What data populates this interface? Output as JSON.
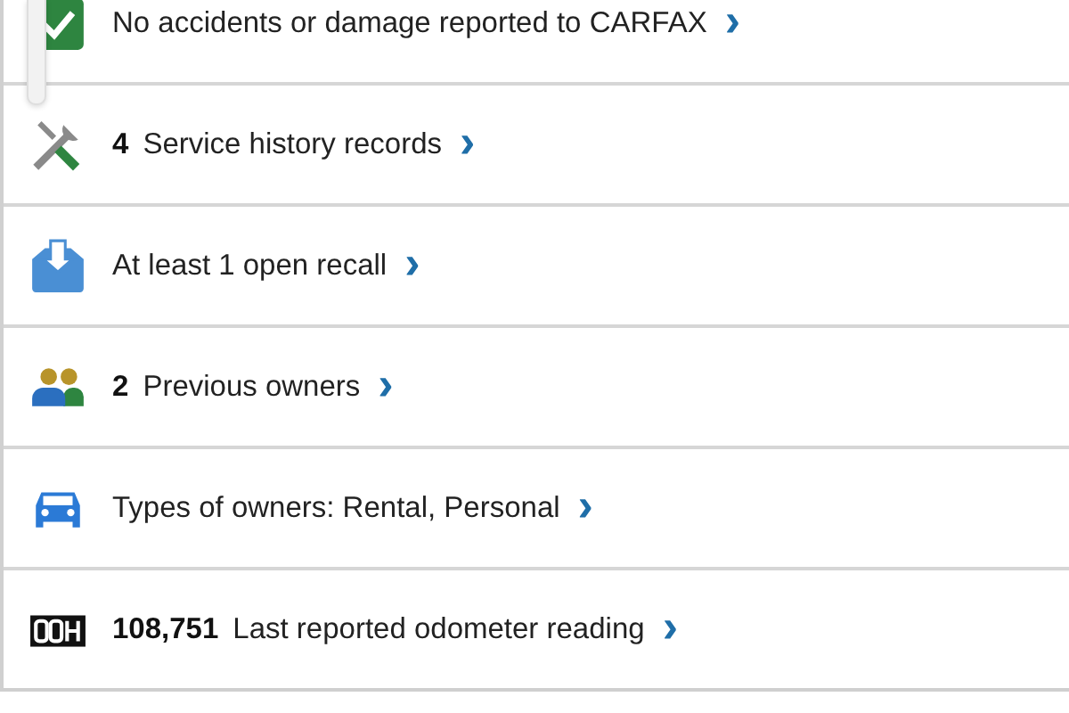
{
  "rows": [
    {
      "kind": "check",
      "label": "No accidents or damage reported to CARFAX",
      "chevron": "›"
    },
    {
      "kind": "tools",
      "count": "4",
      "label": "Service history records",
      "chevron": "›"
    },
    {
      "kind": "recall",
      "label": "At least 1 open recall",
      "chevron": "›"
    },
    {
      "kind": "owners",
      "count": "2",
      "label": "Previous owners",
      "chevron": "›"
    },
    {
      "kind": "car",
      "label": "Types of owners: Rental, Personal",
      "chevron": "›"
    },
    {
      "kind": "odometer",
      "count": "108,751",
      "label": "Last reported odometer reading",
      "chevron": "›"
    }
  ]
}
